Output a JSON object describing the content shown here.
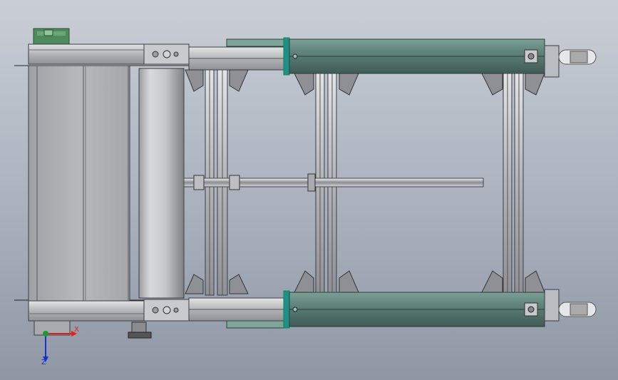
{
  "viewport": {
    "background_top": "#c9ced6",
    "background_bottom": "#8f97a5"
  },
  "model": {
    "frame_color": "#b9bcc0",
    "frame_edge_color": "#3a3d42",
    "cylinder_color": "#5f8079",
    "cylinder_accent": "#1f8f8a",
    "motor_color": "#4e8a5c"
  },
  "triad": {
    "x_label": "X",
    "z_label": "Z",
    "x_color": "#e0201a",
    "z_color": "#1a2fd0",
    "origin_color": "#1e9a2e"
  }
}
